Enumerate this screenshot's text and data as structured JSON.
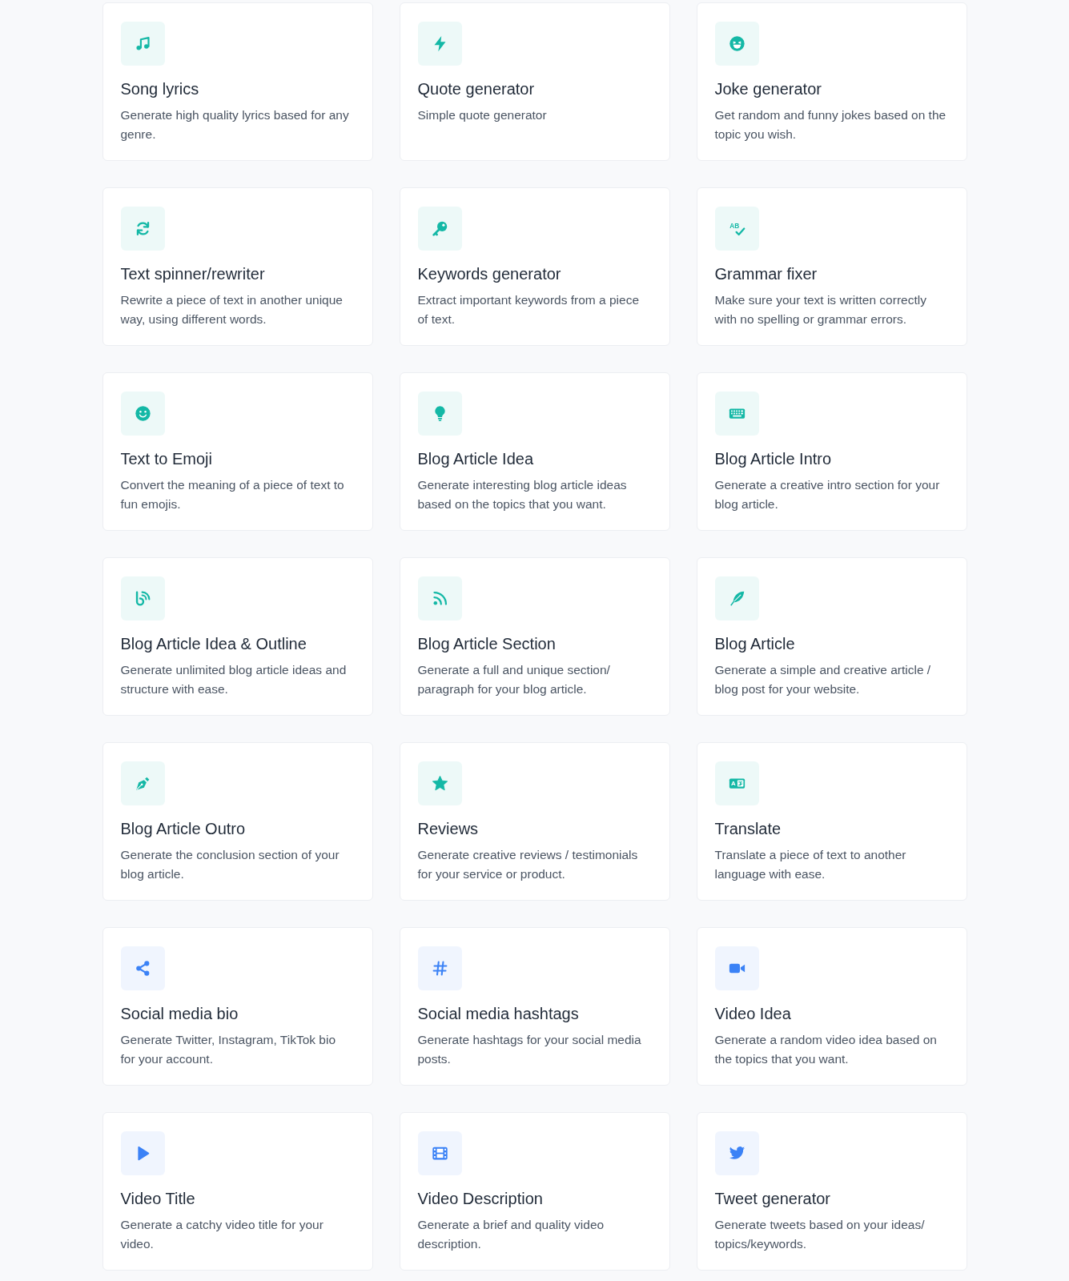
{
  "cards": [
    {
      "title": "Song lyrics",
      "description": "Generate high quality lyrics based for any genre.",
      "color": "#14b8a6"
    },
    {
      "title": "Quote generator",
      "description": "Simple quote generator",
      "color": "#14b8a6"
    },
    {
      "title": "Joke generator",
      "description": "Get random and funny jokes based on the topic you wish.",
      "color": "#14b8a6"
    },
    {
      "title": "Text spinner/rewriter",
      "description": "Rewrite a piece of text in another unique way, using different words.",
      "color": "#14b8a6"
    },
    {
      "title": "Keywords generator",
      "description": "Extract important keywords from a piece of text.",
      "color": "#14b8a6"
    },
    {
      "title": "Grammar fixer",
      "description": "Make sure your text is written correctly with no spelling or grammar errors.",
      "color": "#14b8a6"
    },
    {
      "title": "Text to Emoji",
      "description": "Convert the meaning of a piece of text to fun emojis.",
      "color": "#14b8a6"
    },
    {
      "title": "Blog Article Idea",
      "description": "Generate interesting blog article ideas based on the topics that you want.",
      "color": "#14b8a6"
    },
    {
      "title": "Blog Article Intro",
      "description": "Generate a creative intro section for your blog article.",
      "color": "#14b8a6"
    },
    {
      "title": "Blog Article Idea & Outline",
      "description": "Generate unlimited blog article ideas and structure with ease.",
      "color": "#14b8a6"
    },
    {
      "title": "Blog Article Section",
      "description": "Generate a full and unique section/ paragraph for your blog article.",
      "color": "#14b8a6"
    },
    {
      "title": "Blog Article",
      "description": "Generate a simple and creative article / blog post for your website.",
      "color": "#14b8a6"
    },
    {
      "title": "Blog Article Outro",
      "description": "Generate the conclusion section of your blog article.",
      "color": "#14b8a6"
    },
    {
      "title": "Reviews",
      "description": "Generate creative reviews / testimonials for your service or product.",
      "color": "#14b8a6"
    },
    {
      "title": "Translate",
      "description": "Translate a piece of text to another language with ease.",
      "color": "#14b8a6"
    },
    {
      "title": "Social media bio",
      "description": "Generate Twitter, Instagram, TikTok bio for your account.",
      "color": "#3b82f6"
    },
    {
      "title": "Social media hashtags",
      "description": "Generate hashtags for your social media posts.",
      "color": "#3b82f6"
    },
    {
      "title": "Video Idea",
      "description": "Generate a random video idea based on the topics that you want.",
      "color": "#3b82f6"
    },
    {
      "title": "Video Title",
      "description": "Generate a catchy video title for your video.",
      "color": "#3b82f6"
    },
    {
      "title": "Video Description",
      "description": "Generate a brief and quality video description.",
      "color": "#3b82f6"
    },
    {
      "title": "Tweet generator",
      "description": "Generate tweets based on your ideas/ topics/keywords.",
      "color": "#3b82f6"
    }
  ],
  "icon_labels": [
    {
      "text": "AB"
    },
    {
      "text": "A"
    }
  ]
}
